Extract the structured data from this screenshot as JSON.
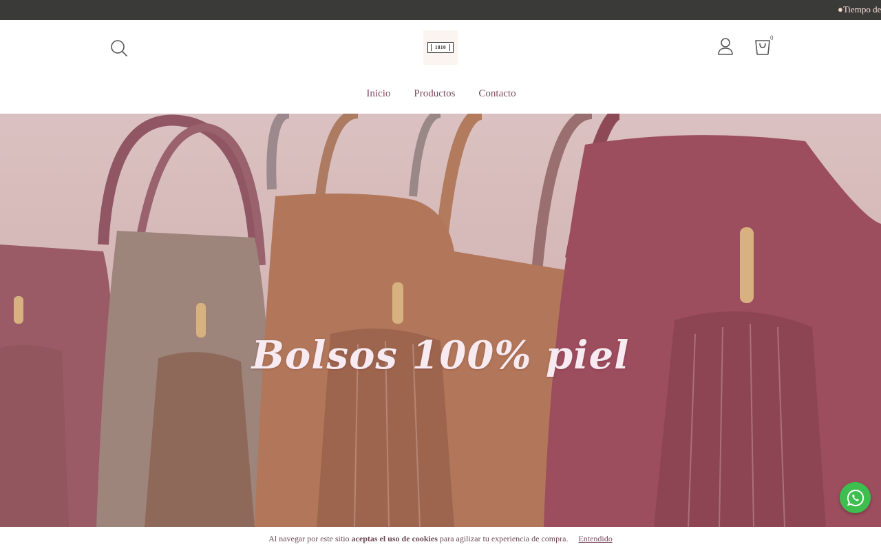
{
  "announcement": {
    "text": "●Tiempo de e"
  },
  "header": {
    "logo_text": "1810",
    "cart_count": "0",
    "icons": {
      "search": "search-icon",
      "account": "user-icon",
      "cart": "shopping-bag-icon"
    }
  },
  "nav": {
    "items": [
      {
        "label": "Inicio"
      },
      {
        "label": "Productos"
      },
      {
        "label": "Contacto"
      }
    ]
  },
  "hero": {
    "title": "Bolsos 100% piel"
  },
  "cookie": {
    "text_before": "Al navegar por este sitio ",
    "text_bold": "aceptas el uso de cookies",
    "text_after": " para agilizar tu experiencia de compra.",
    "accept_label": "Entendido"
  },
  "whatsapp": {
    "icon": "whatsapp-icon"
  },
  "colors": {
    "accent": "#7a4a5e",
    "announce_bg": "#3a3a38",
    "whatsapp": "#3dbe4e"
  }
}
